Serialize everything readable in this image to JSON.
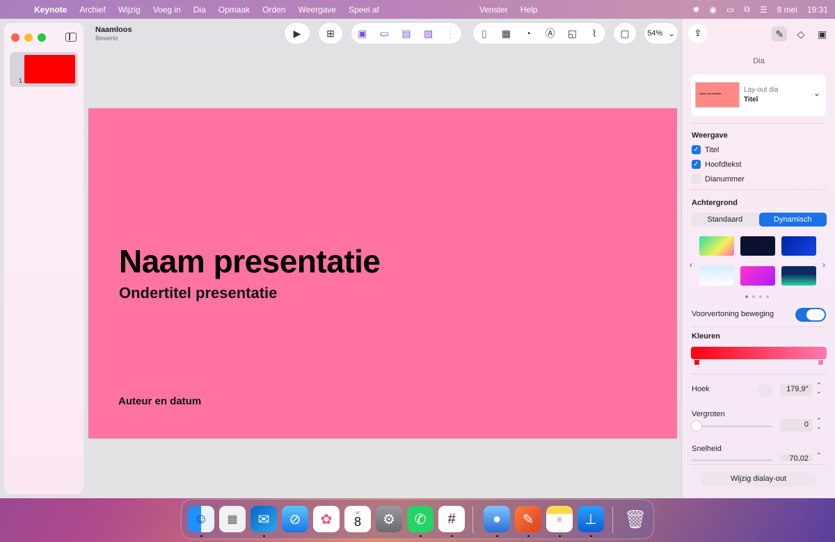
{
  "menubar": {
    "apple": "",
    "app_name": "Keynote",
    "items": [
      "Archief",
      "Wijzig",
      "Voeg in",
      "Dia",
      "Opmaak",
      "Orden",
      "Weergave",
      "Speel af"
    ],
    "center_items": [
      "Venster",
      "Help"
    ],
    "date": "8 mei",
    "time": "19:31"
  },
  "document": {
    "title": "Naamloos",
    "status": "Bewerkt"
  },
  "toolbar": {
    "zoom": "54%"
  },
  "navigator": {
    "slide_number": "1",
    "thumb_color": "#ff0000"
  },
  "slide": {
    "background": "#ff73a3",
    "title": "Naam presentatie",
    "subtitle": "Ondertitel presentatie",
    "author": "Auteur en datum"
  },
  "inspector": {
    "header": "Dia",
    "layout_caption": "Lay-out dia",
    "layout_value": "Titel",
    "layout_thumb_title": "Naam presentatie",
    "view_label": "Weergave",
    "view_options": [
      {
        "label": "Titel",
        "checked": true
      },
      {
        "label": "Hoofdtekst",
        "checked": true
      },
      {
        "label": "Dianummer",
        "checked": false
      }
    ],
    "background_label": "Achtergrond",
    "segments": [
      "Standaard",
      "Dynamisch"
    ],
    "active_segment": "Dynamisch",
    "motion_preview_label": "Voorvertoning beweging",
    "motion_preview_on": true,
    "colors_label": "Kleuren",
    "gradient_start": "#ff0012",
    "gradient_end": "#ff7ab0",
    "angle_label": "Hoek",
    "angle_value": "179,9°",
    "scale_label": "Vergroten",
    "scale_value": "0",
    "speed_label": "Snelheid",
    "speed_value": "70,02",
    "edit_layout_button": "Wijzig dialay-out"
  },
  "accent_color": "#1a73e8",
  "dock": {
    "apps": [
      "finder-icon",
      "launchpad-icon",
      "outlook-icon",
      "safari-icon",
      "photos-icon",
      "calendar-icon",
      "system-settings-icon",
      "whatsapp-icon",
      "slack-icon",
      "unknown-app-icon",
      "pages-icon",
      "notes-icon",
      "keynote-icon",
      "trash-icon"
    ],
    "calendar_day": "8",
    "calendar_month": "vr"
  }
}
